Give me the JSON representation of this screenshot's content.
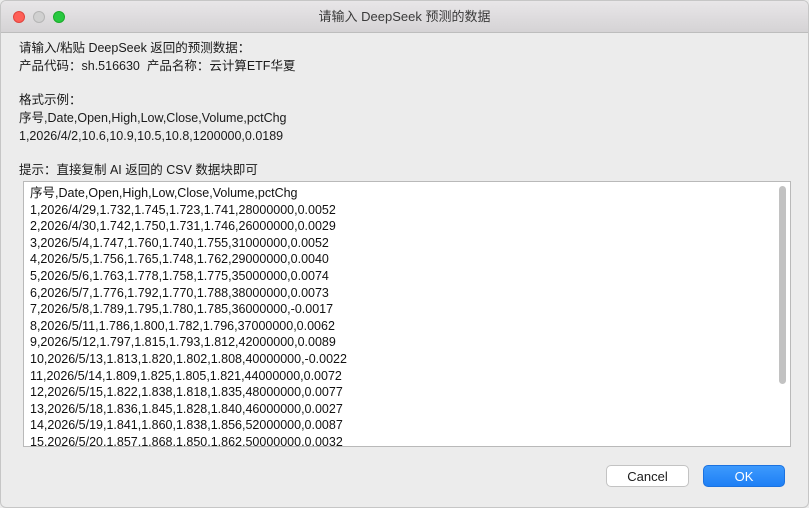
{
  "window": {
    "title": "请输入 DeepSeek 预测的数据"
  },
  "prompt": {
    "line1": "请输入/粘贴 DeepSeek 返回的预测数据：",
    "line2": "产品代码：sh.516630  产品名称：云计算ETF华夏",
    "format_heading": "格式示例：",
    "format_header": "序号,Date,Open,High,Low,Close,Volume,pctChg",
    "format_example": "1,2026/4/2,10.6,10.9,10.5,10.8,1200000,0.0189",
    "hint": "提示：直接复制 AI 返回的 CSV 数据块即可"
  },
  "textarea": {
    "lines": [
      "序号,Date,Open,High,Low,Close,Volume,pctChg",
      "1,2026/4/29,1.732,1.745,1.723,1.741,28000000,0.0052",
      "2,2026/4/30,1.742,1.750,1.731,1.746,26000000,0.0029",
      "3,2026/5/4,1.747,1.760,1.740,1.755,31000000,0.0052",
      "4,2026/5/5,1.756,1.765,1.748,1.762,29000000,0.0040",
      "5,2026/5/6,1.763,1.778,1.758,1.775,35000000,0.0074",
      "6,2026/5/7,1.776,1.792,1.770,1.788,38000000,0.0073",
      "7,2026/5/8,1.789,1.795,1.780,1.785,36000000,-0.0017",
      "8,2026/5/11,1.786,1.800,1.782,1.796,37000000,0.0062",
      "9,2026/5/12,1.797,1.815,1.793,1.812,42000000,0.0089",
      "10,2026/5/13,1.813,1.820,1.802,1.808,40000000,-0.0022",
      "11,2026/5/14,1.809,1.825,1.805,1.821,44000000,0.0072",
      "12,2026/5/15,1.822,1.838,1.818,1.835,48000000,0.0077",
      "13,2026/5/18,1.836,1.845,1.828,1.840,46000000,0.0027",
      "14,2026/5/19,1.841,1.860,1.838,1.856,52000000,0.0087",
      "15,2026/5/20,1.857,1.868,1.850,1.862,50000000,0.0032"
    ]
  },
  "buttons": {
    "cancel": "Cancel",
    "ok": "OK"
  },
  "colors": {
    "accent": "#1e7ff5",
    "close": "#fe5f57",
    "maximize": "#28c840"
  }
}
